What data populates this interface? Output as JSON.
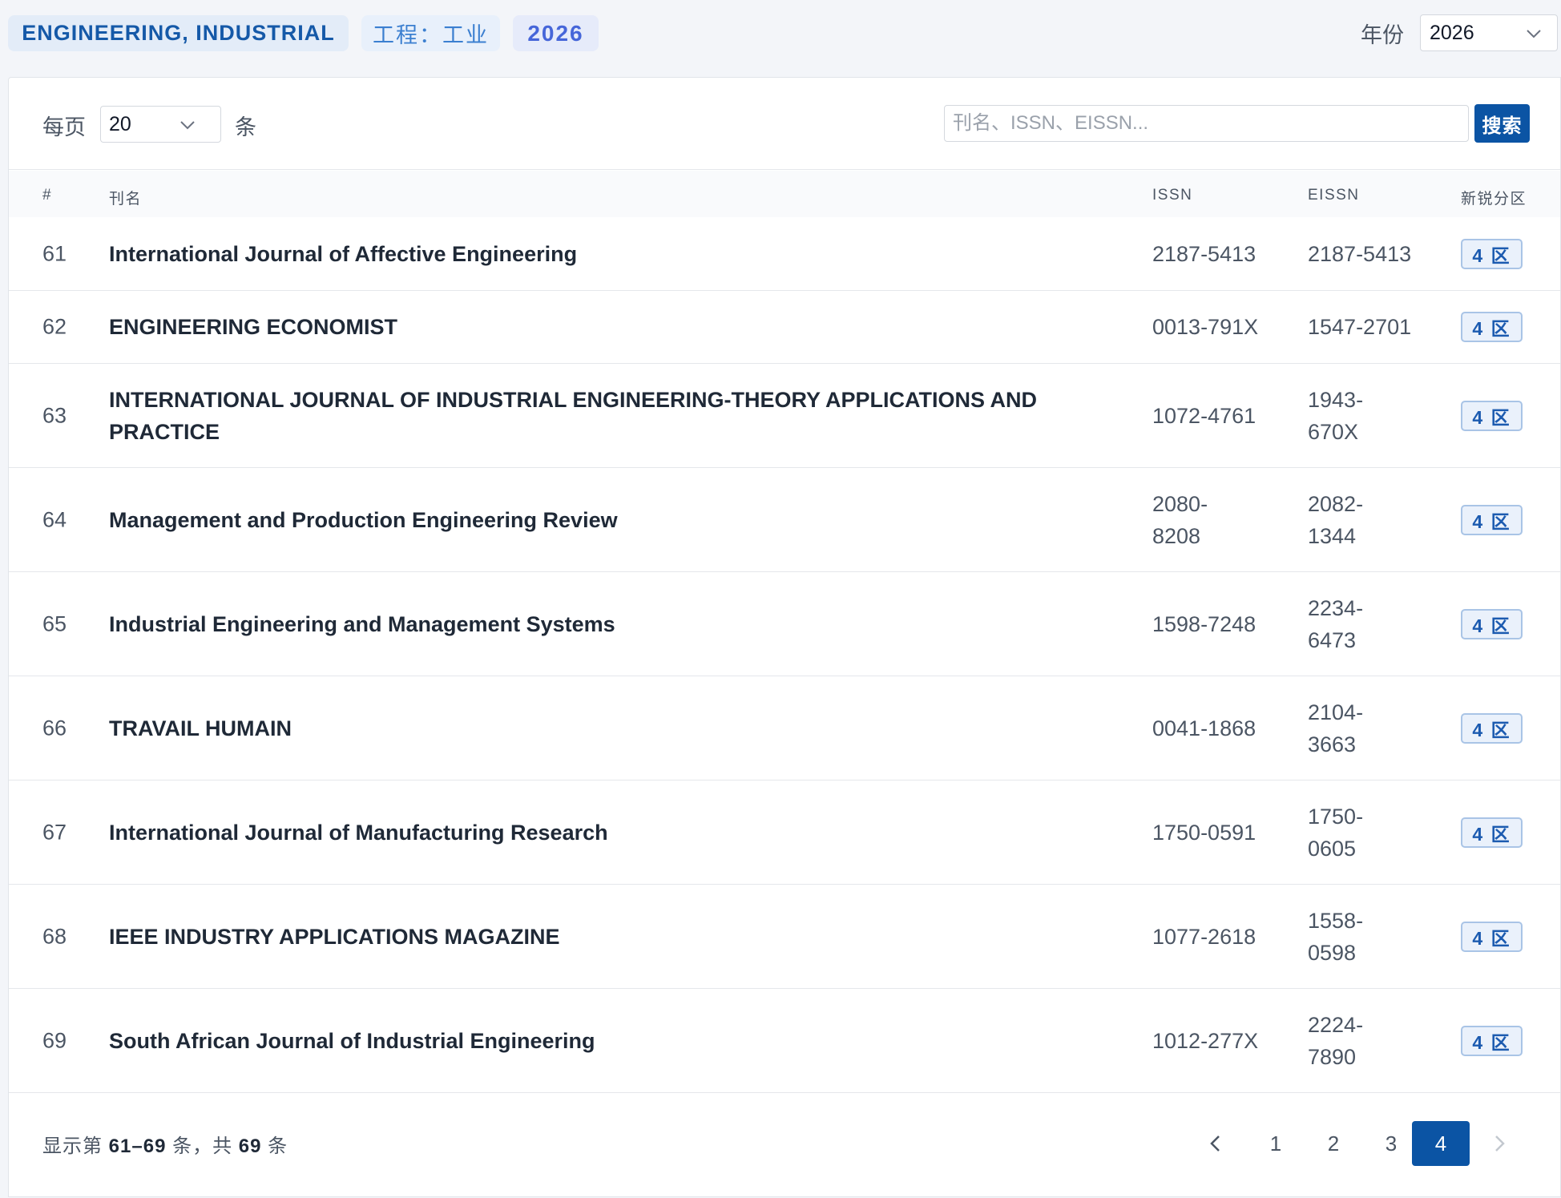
{
  "header": {
    "category_en": "ENGINEERING, INDUSTRIAL",
    "category_cn": "工程：工业",
    "year_badge": "2026",
    "year_label": "年份",
    "year_value": "2026"
  },
  "toolbar": {
    "per_page_label": "每页",
    "per_page_value": "20",
    "per_page_unit": "条",
    "search_placeholder": "刊名、ISSN、EISSN...",
    "search_value": "",
    "search_button": "搜索"
  },
  "table": {
    "columns": {
      "num": "#",
      "name": "刊名",
      "issn": "ISSN",
      "eissn": "EISSN",
      "zone": "新锐分区"
    },
    "rows": [
      {
        "num": "61",
        "name": "International Journal of Affective Engineering",
        "issn": "2187-5413",
        "eissn": "2187-5413",
        "zone": "4 区"
      },
      {
        "num": "62",
        "name": "ENGINEERING ECONOMIST",
        "issn": "0013-791X",
        "eissn": "1547-2701",
        "zone": "4 区"
      },
      {
        "num": "63",
        "name": "INTERNATIONAL JOURNAL OF INDUSTRIAL ENGINEERING-THEORY APPLICATIONS AND PRACTICE",
        "issn": "1072-4761",
        "eissn": "1943-670X",
        "zone": "4 区"
      },
      {
        "num": "64",
        "name": "Management and Production Engineering Review",
        "issn": "2080-8208",
        "eissn": "2082-1344",
        "zone": "4 区"
      },
      {
        "num": "65",
        "name": "Industrial Engineering and Management Systems",
        "issn": "1598-7248",
        "eissn": "2234-6473",
        "zone": "4 区"
      },
      {
        "num": "66",
        "name": "TRAVAIL HUMAIN",
        "issn": "0041-1868",
        "eissn": "2104-3663",
        "zone": "4 区"
      },
      {
        "num": "67",
        "name": "International Journal of Manufacturing Research",
        "issn": "1750-0591",
        "eissn": "1750-0605",
        "zone": "4 区"
      },
      {
        "num": "68",
        "name": "IEEE INDUSTRY APPLICATIONS MAGAZINE",
        "issn": "1077-2618",
        "eissn": "1558-0598",
        "zone": "4 区"
      },
      {
        "num": "69",
        "name": "South African Journal of Industrial Engineering",
        "issn": "1012-277X",
        "eissn": "2224-7890",
        "zone": "4 区"
      }
    ]
  },
  "footer": {
    "summary_prefix": "显示第",
    "summary_range": "61–69",
    "summary_middle": "条，共",
    "summary_total": "69",
    "summary_suffix": "条",
    "pages": [
      "1",
      "2",
      "3",
      "4"
    ],
    "current_page": "4"
  },
  "colors": {
    "accent": "#0b54a4",
    "zone_badge_bg": "#eaf1fb",
    "zone_badge_text": "#1c5bb0"
  }
}
